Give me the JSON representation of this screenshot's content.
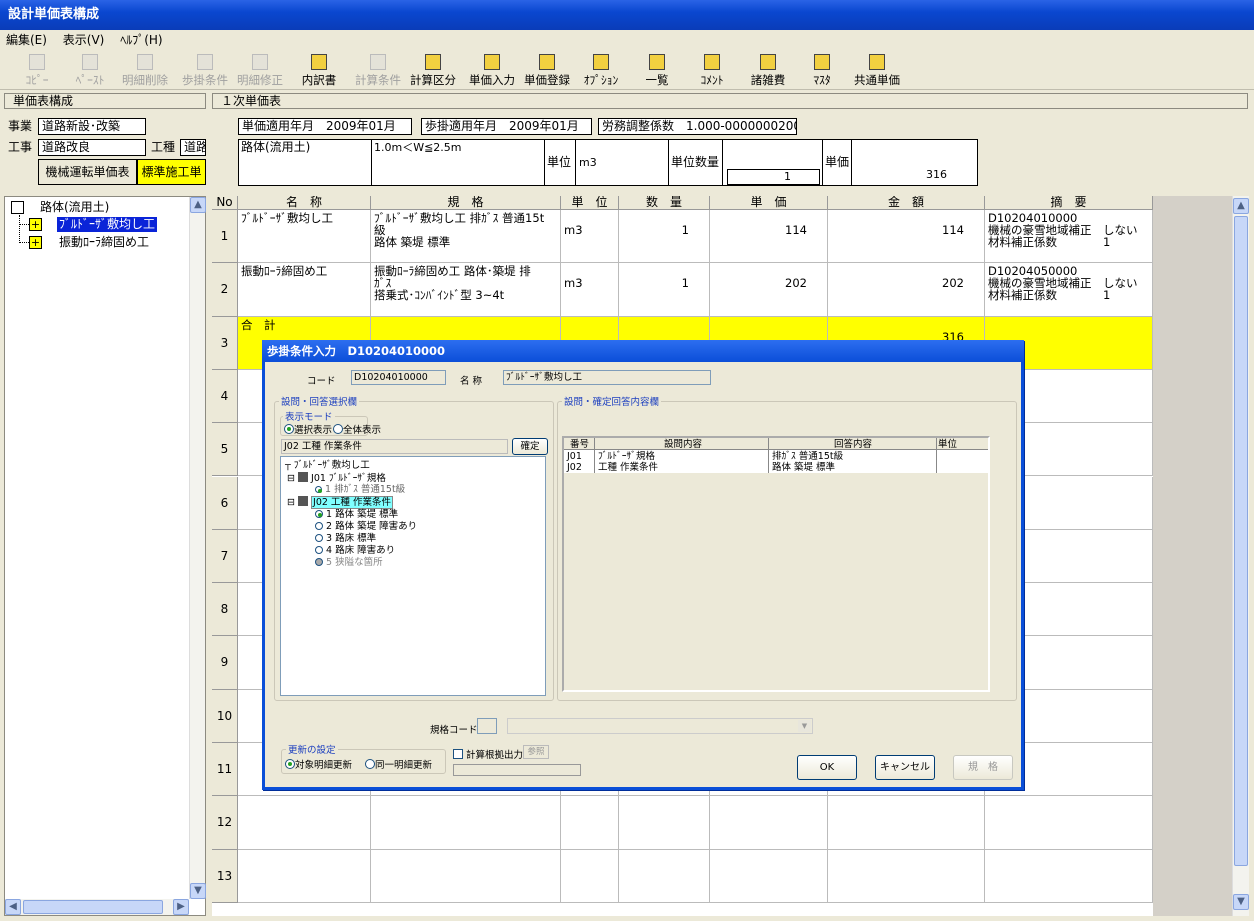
{
  "window": {
    "title": "設計単価表構成"
  },
  "menu": [
    "編集(E)",
    "表示(V)",
    "ﾍﾙﾌﾟ(H)"
  ],
  "toolbar": {
    "copy": "ｺﾋﾟｰ",
    "paste": "ﾍﾟｰｽﾄ",
    "delete_detail": "明細削除",
    "step_condition": "歩掛条件",
    "modify_detail": "明細修正",
    "breakdown": "内訳書",
    "calc_condition": "計算条件",
    "calc_class": "計算区分",
    "unit_price_input": "単価入力",
    "unit_price_register": "単価登録",
    "options": "ｵﾌﾟｼｮﾝ",
    "list": "一覧",
    "comment": "ｺﾒﾝﾄ",
    "misc_cost": "諸雑費",
    "master": "ﾏｽﾀ",
    "common_price": "共通単価"
  },
  "left": {
    "header": "単価表構成",
    "jigyo_label": "事業",
    "jigyo_value": "道路新設･改築",
    "koji_label": "工事",
    "koji_value": "道路改良",
    "koshu_label": "工種",
    "koshu_value": "道路",
    "tab1": "機械運転単価表",
    "tab2": "標準施工単",
    "tree_root": "路体(流用土)",
    "tree_items": [
      "ﾌﾞﾙﾄﾞｰｻﾞ敷均し工",
      "振動ﾛｰﾗ締固め工"
    ]
  },
  "right": {
    "header": "１次単価表",
    "apply_ym": "単価適用年月　2009年01月",
    "step_ym": "歩掛適用年月　2009年01月",
    "labor": "労務調整係数　1.000-00000002000",
    "name": "路体(流用土)",
    "spec": "1.0m＜W≦2.5m",
    "unit_label": "単位",
    "unit": "m3",
    "qty_label": "単位数量",
    "qty": "1",
    "price_label": "単価",
    "price": "316"
  },
  "grid": {
    "headers": [
      "No",
      "名　称",
      "規　格",
      "単　位",
      "数　量",
      "単　価",
      "金　額",
      "摘　要"
    ],
    "rows": [
      {
        "no": "1",
        "name": "ﾌﾞﾙﾄﾞｰｻﾞ敷均し工",
        "spec": "ﾌﾞﾙﾄﾞｰｻﾞ敷均し工 排ｶﾞｽ 普通15t\n級\n路体 築堤 標準",
        "unit": "m3",
        "qty": "1",
        "price": "114",
        "amount": "114",
        "note": "D10204010000\n機械の豪雪地域補正　しない\n材料補正係数　　　　1"
      },
      {
        "no": "2",
        "name": "振動ﾛｰﾗ締固め工",
        "spec": "振動ﾛｰﾗ締固め工 路体･築堤 排\nｶﾞｽ\n搭乗式･ｺﾝﾊﾞｲﾝﾄﾞ型 3~4t",
        "unit": "m3",
        "qty": "1",
        "price": "202",
        "amount": "202",
        "note": "D10204050000\n機械の豪雪地域補正　しない\n材料補正係数　　　　1"
      },
      {
        "no": "3",
        "name": "合　計",
        "spec": "",
        "unit": "",
        "qty": "",
        "price": "",
        "amount": "316",
        "note": ""
      },
      {
        "no": "4"
      },
      {
        "no": "5"
      },
      {
        "no": "6"
      },
      {
        "no": "7"
      },
      {
        "no": "8"
      },
      {
        "no": "9"
      },
      {
        "no": "10"
      },
      {
        "no": "11"
      },
      {
        "no": "12"
      },
      {
        "no": "13"
      }
    ]
  },
  "dialog": {
    "title": "歩掛条件入力　D10204010000",
    "code_label": "コード",
    "code": "D10204010000",
    "name_label": "名 称",
    "name": "ﾌﾞﾙﾄﾞｰｻﾞ敷均し工",
    "group_left": "設問・回答選択欄",
    "mode_label": "表示モード",
    "mode_sel": "選択表示",
    "mode_all": "全体表示",
    "question": "J02 工種 作業条件",
    "confirm": "確定",
    "tree_root": "ﾌﾞﾙﾄﾞｰｻﾞ敷均し工",
    "q1": "J01 ﾌﾞﾙﾄﾞｰｻﾞ規格",
    "q1a": "1 排ｶﾞｽ 普通15t級",
    "q2": "J02 工種 作業条件",
    "answers": [
      "1 路体 築堤 標準",
      "2 路体 築堤 障害あり",
      "3 路床 標準",
      "4 路床 障害あり",
      "5 狭隘な箇所"
    ],
    "group_right": "設問・確定回答内容欄",
    "table_headers": [
      "番号",
      "設問内容",
      "回答内容",
      "単位"
    ],
    "table_rows": [
      {
        "no": "J01",
        "q": "ﾌﾞﾙﾄﾞｰｻﾞ規格",
        "a": "排ｶﾞｽ 普通15t級",
        "u": ""
      },
      {
        "no": "J02",
        "q": "工種 作業条件",
        "a": "路体 築堤 標準",
        "u": ""
      }
    ],
    "spec_code_label": "規格コード",
    "update_group": "更新の設定",
    "update_target": "対象明細更新",
    "update_same": "同一明細更新",
    "calc_out": "計算根拠出力",
    "ref": "参照",
    "ok": "OK",
    "cancel": "キャンセル",
    "spec_btn": "規　格"
  }
}
